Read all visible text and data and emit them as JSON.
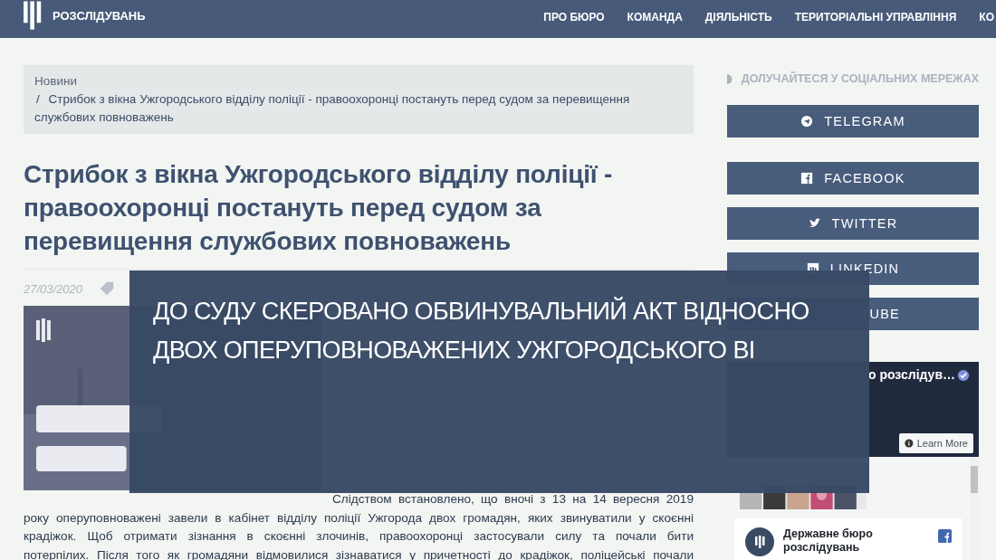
{
  "header": {
    "logo_text": "РОЗСЛІДУВАНЬ",
    "nav": [
      {
        "label": "ПРО БЮРО"
      },
      {
        "label": "КОМАНДА"
      },
      {
        "label": "ДІЯЛЬНІСТЬ"
      },
      {
        "label": "ТЕРИТОРІАЛЬНІ УПРАВЛІННЯ"
      },
      {
        "label": "КО"
      }
    ]
  },
  "breadcrumb": {
    "home": "Новини",
    "separator": "/",
    "current": "Стрибок з вікна Ужгородського відділу поліції - правоохоронці постануть перед судом за перевищення службових повноважень"
  },
  "article": {
    "title": "Стрибок з вікна Ужгородського відділу поліції - правоохоронці постануть перед судом за перевищення службових повноважень",
    "date": "27/03/2020",
    "lines": [
      "Слідством встановлено, що вночі з 13 на 14 вересня 2019",
      "року оперуповноважені завели в кабінет відділу поліції Ужгорода двох громадян, яких звинуватили у скоєнні",
      "крадіжок. Щоб отримати зізнання в скоєнні злочинів, правоохоронці застосували силу та почали бити",
      "потерпілих. Після того як громадяни відмовилися зізнаватися у причетності до крадіжок, поліцейські почали"
    ]
  },
  "caption": {
    "lines": [
      "ДО СУДУ СКЕРОВАНО ОБВИНУВАЛЬНИЙ АКТ ВІДНОСНО",
      "ДВОХ ОПЕРУПОВНОВАЖЕНИХ УЖГОРОДСЬКОГО ВІ"
    ]
  },
  "sidebar": {
    "heading": "ДОЛУЧАЙТЕСЯ У СОЦІАЛЬНИХ МЕРЕЖАХ",
    "social": [
      {
        "kind": "telegram",
        "label": "TELEGRAM"
      },
      {
        "kind": "facebook",
        "label": "FACEBOOK"
      },
      {
        "kind": "twitter",
        "label": "TWITTER"
      },
      {
        "kind": "linkedin",
        "label": "LINKEDIN"
      },
      {
        "kind": "youtube",
        "label": "TUBE"
      }
    ],
    "widget": {
      "page_name": "о розслідув…",
      "button": "Learn More",
      "post_author": "Державне бюро розслідувань"
    }
  }
}
